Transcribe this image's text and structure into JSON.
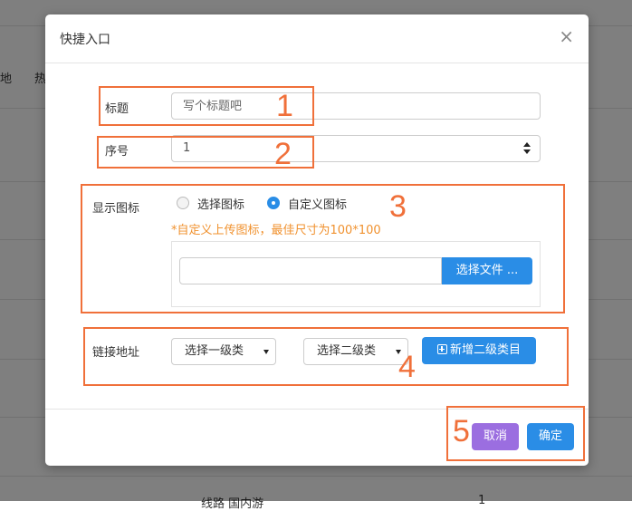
{
  "background": {
    "frag_left": "地",
    "frag_mid": "热",
    "frag_bottom_text": "线路 国内游",
    "frag_bottom_num": "1"
  },
  "modal": {
    "title": "快捷入口",
    "close_glyph": "×",
    "fields": {
      "title_label": "标题",
      "title_placeholder": "写个标题吧",
      "order_label": "序号",
      "order_value": "1",
      "icon_label": "显示图标",
      "icon_option_choose": "选择图标",
      "icon_option_custom": "自定义图标",
      "icon_hint": "*自定义上传图标，最佳尺寸为100*100",
      "choose_file_button": "选择文件 ...",
      "link_label": "链接地址",
      "select_primary": "选择一级类",
      "select_secondary": "选择二级类",
      "add_secondary_button": "新增二级类目"
    },
    "footer": {
      "cancel_button": "取消",
      "confirm_button": "确定"
    }
  },
  "annotations": {
    "n1": "1",
    "n2": "2",
    "n3": "3",
    "n4": "4",
    "n5": "5"
  },
  "colors": {
    "accent_blue": "#2a8de6",
    "cancel_purple": "#9b6ee0",
    "hint_orange": "#f0912e",
    "annotation_orange": "#f0703a"
  }
}
